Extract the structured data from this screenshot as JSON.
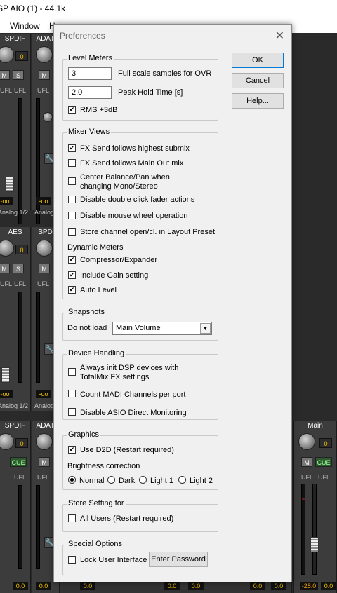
{
  "window": {
    "title": "SP AIO (1) - 44.1k"
  },
  "menu": {
    "window": "Window",
    "help": "He"
  },
  "mixer": {
    "row1": {
      "ch1": "SPDIF",
      "ch2": "ADAT",
      "knob": "0"
    },
    "row2": {
      "ch1": "AES",
      "ch2": "SPD",
      "knob": "0"
    },
    "row3": {
      "ch1": "SPDIF",
      "ch2": "ADAT",
      "main": "Main",
      "knob": "0"
    },
    "m": "M",
    "s": "S",
    "cue": "CUE",
    "ufl": "UFL",
    "analog12": "Analog 1/2",
    "analog": "Analog",
    "neg_inf": "-oo",
    "zero": "0.0",
    "main_val": "-28.0"
  },
  "dialog": {
    "title": "Preferences",
    "ok": "OK",
    "cancel": "Cancel",
    "help": "Help...",
    "level_meters": {
      "legend": "Level Meters",
      "ovr_value": "3",
      "ovr_label": "Full scale samples for OVR",
      "hold_value": "2.0",
      "hold_label": "Peak Hold Time [s]",
      "rms_label": "RMS +3dB",
      "rms_checked": true
    },
    "mixer_views": {
      "legend": "Mixer Views",
      "fx_highest": "FX Send follows highest submix",
      "fx_main": "FX Send follows Main Out mix",
      "center_balance_1": "Center Balance/Pan when",
      "center_balance_2": "changing Mono/Stereo",
      "disable_double": "Disable double click fader actions",
      "disable_wheel": "Disable mouse wheel operation",
      "store_channel": "Store channel open/cl. in Layout Preset",
      "dynamic_meters": "Dynamic Meters",
      "compressor": "Compressor/Expander",
      "include_gain": "Include Gain setting",
      "auto_level": "Auto Level"
    },
    "snapshots": {
      "legend": "Snapshots",
      "do_not_load": "Do not load",
      "selected": "Main Volume"
    },
    "device_handling": {
      "legend": "Device Handling",
      "always_init_1": "Always init DSP devices with",
      "always_init_2": "TotalMix FX settings",
      "count_madi": "Count MADI Channels per port",
      "disable_asio": "Disable ASIO Direct Monitoring"
    },
    "graphics": {
      "legend": "Graphics",
      "use_d2d": "Use D2D (Restart required)",
      "brightness": "Brightness correction",
      "normal": "Normal",
      "dark": "Dark",
      "light1": "Light 1",
      "light2": "Light 2"
    },
    "store_setting": {
      "legend": "Store Setting for",
      "all_users": "All Users (Restart required)"
    },
    "special": {
      "legend": "Special Options",
      "lock_ui": "Lock User Interface",
      "enter_password": "Enter Password"
    }
  }
}
